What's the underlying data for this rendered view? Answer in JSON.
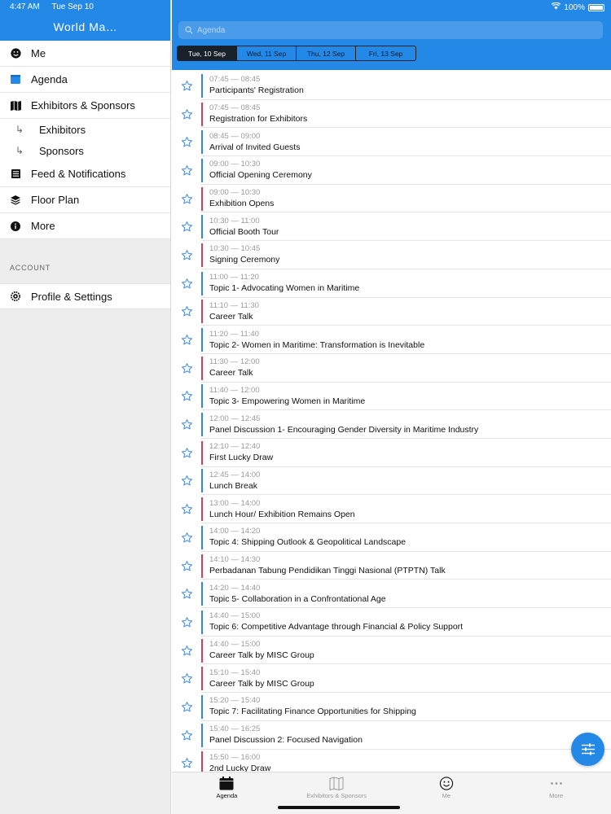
{
  "status": {
    "time": "4:47 AM",
    "date": "Tue Sep 10",
    "battery": "100%"
  },
  "sidebar": {
    "title": "World Ma…",
    "items": [
      {
        "label": "Me",
        "icon": "smiley-icon"
      },
      {
        "label": "Agenda",
        "icon": "calendar-icon"
      },
      {
        "label": "Exhibitors & Sponsors",
        "icon": "map-icon"
      },
      {
        "label": "Exhibitors",
        "icon": "sub-arrow-icon"
      },
      {
        "label": "Sponsors",
        "icon": "sub-arrow-icon"
      },
      {
        "label": "Feed & Notifications",
        "icon": "newspaper-icon"
      },
      {
        "label": "Floor Plan",
        "icon": "layers-icon"
      },
      {
        "label": "More",
        "icon": "info-icon"
      }
    ],
    "account_label": "ACCOUNT",
    "profile": {
      "label": "Profile & Settings",
      "icon": "gear-icon"
    }
  },
  "search": {
    "placeholder": "Agenda"
  },
  "date_tabs": [
    {
      "label": "Tue, 10 Sep",
      "active": true
    },
    {
      "label": "Wed, 11 Sep",
      "active": false
    },
    {
      "label": "Thu, 12 Sep",
      "active": false
    },
    {
      "label": "Fri, 13 Sep",
      "active": false
    }
  ],
  "colors": {
    "accent": "#2388e6",
    "blue_track": "#3a86d6",
    "red_track": "#d2405c",
    "star": "#3a86d6"
  },
  "agenda": [
    {
      "time": "07:45 — 08:45",
      "title": "Participants' Registration",
      "track": "blue"
    },
    {
      "time": "07:45 — 08:45",
      "title": "Registration for Exhibitors",
      "track": "red"
    },
    {
      "time": "08:45 — 09:00",
      "title": "Arrival of Invited Guests",
      "track": "blue"
    },
    {
      "time": "09:00 — 10:30",
      "title": "Official Opening Ceremony",
      "track": "blue"
    },
    {
      "time": "09:00 — 10:30",
      "title": "Exhibition Opens",
      "track": "red"
    },
    {
      "time": "10:30 — 11:00",
      "title": "Official Booth Tour",
      "track": "blue"
    },
    {
      "time": "10:30 — 10:45",
      "title": "Signing Ceremony",
      "track": "red"
    },
    {
      "time": "11:00 — 11:20",
      "title": "Topic 1- Advocating Women in Maritime",
      "track": "blue"
    },
    {
      "time": "11:10 — 11:30",
      "title": "Career Talk",
      "track": "red"
    },
    {
      "time": "11:20 — 11:40",
      "title": "Topic 2- Women in Maritime: Transformation is Inevitable",
      "track": "blue"
    },
    {
      "time": "11:30 — 12:00",
      "title": "Career Talk",
      "track": "red"
    },
    {
      "time": "11:40 — 12:00",
      "title": "Topic 3- Empowering Women in Maritime",
      "track": "blue"
    },
    {
      "time": "12:00 — 12:45",
      "title": "Panel Discussion 1- Encouraging Gender Diversity in Maritime Industry",
      "track": "blue"
    },
    {
      "time": "12:10 — 12:40",
      "title": "First Lucky Draw",
      "track": "red"
    },
    {
      "time": "12:45 — 14:00",
      "title": "Lunch Break",
      "track": "blue"
    },
    {
      "time": "13:00 — 14:00",
      "title": "Lunch Hour/ Exhibition Remains Open",
      "track": "red"
    },
    {
      "time": "14:00 — 14:20",
      "title": "Topic 4: Shipping Outlook & Geopolitical Landscape",
      "track": "blue"
    },
    {
      "time": "14:10 — 14:30",
      "title": "Perbadanan Tabung Pendidikan Tinggi Nasional (PTPTN) Talk",
      "track": "red"
    },
    {
      "time": "14:20 — 14:40",
      "title": "Topic 5- Collaboration in a Confrontational Age",
      "track": "blue"
    },
    {
      "time": "14:40 — 15:00",
      "title": "Topic 6: Competitive Advantage through Financial & Policy Support",
      "track": "blue"
    },
    {
      "time": "14:40 — 15:00",
      "title": "Career Talk by MISC Group",
      "track": "red"
    },
    {
      "time": "15:10 — 15:40",
      "title": "Career Talk by MISC Group",
      "track": "red"
    },
    {
      "time": "15:20 — 15:40",
      "title": "Topic 7: Facilitating Finance Opportunities for Shipping",
      "track": "blue"
    },
    {
      "time": "15:40 — 16:25",
      "title": "Panel Discussion 2: Focused Navigation",
      "track": "blue"
    },
    {
      "time": "15:50 — 16:00",
      "title": "2nd Lucky Draw",
      "track": "red"
    }
  ],
  "tabbar": [
    {
      "label": "Agenda",
      "icon": "calendar-icon",
      "active": true
    },
    {
      "label": "Exhibitors & Sponsors",
      "icon": "map-icon",
      "active": false
    },
    {
      "label": "Me",
      "icon": "smiley-icon",
      "active": false
    },
    {
      "label": "More",
      "icon": "ellipsis-icon",
      "active": false
    }
  ]
}
